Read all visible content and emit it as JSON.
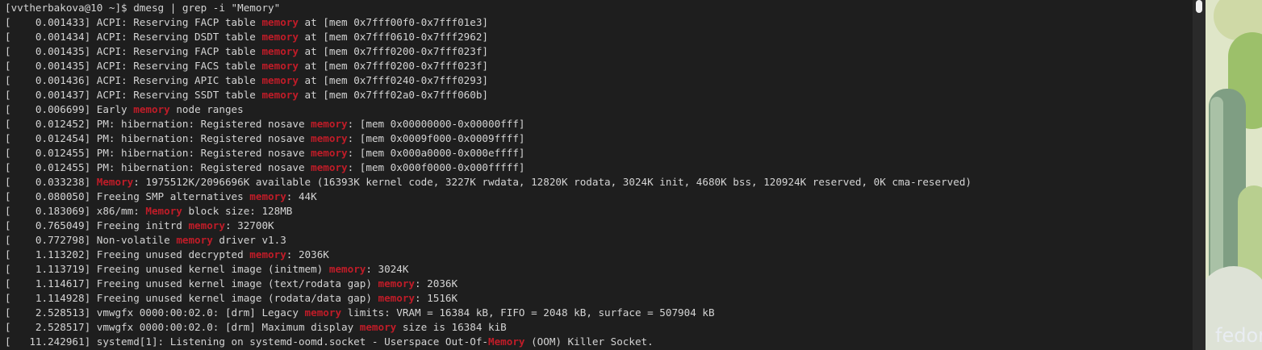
{
  "terminal": {
    "lines": [
      [
        {
          "t": "[vvtherbakova@10 ~]$ dmesg | grep -i \"Memory\""
        }
      ],
      [
        {
          "t": "[    0.001433] ACPI: Reserving FACP table "
        },
        {
          "t": "memory",
          "hl": true
        },
        {
          "t": " at [mem 0x7fff00f0-0x7fff01e3]"
        }
      ],
      [
        {
          "t": "[    0.001434] ACPI: Reserving DSDT table "
        },
        {
          "t": "memory",
          "hl": true
        },
        {
          "t": " at [mem 0x7fff0610-0x7fff2962]"
        }
      ],
      [
        {
          "t": "[    0.001435] ACPI: Reserving FACP table "
        },
        {
          "t": "memory",
          "hl": true
        },
        {
          "t": " at [mem 0x7fff0200-0x7fff023f]"
        }
      ],
      [
        {
          "t": "[    0.001435] ACPI: Reserving FACS table "
        },
        {
          "t": "memory",
          "hl": true
        },
        {
          "t": " at [mem 0x7fff0200-0x7fff023f]"
        }
      ],
      [
        {
          "t": "[    0.001436] ACPI: Reserving APIC table "
        },
        {
          "t": "memory",
          "hl": true
        },
        {
          "t": " at [mem 0x7fff0240-0x7fff0293]"
        }
      ],
      [
        {
          "t": "[    0.001437] ACPI: Reserving SSDT table "
        },
        {
          "t": "memory",
          "hl": true
        },
        {
          "t": " at [mem 0x7fff02a0-0x7fff060b]"
        }
      ],
      [
        {
          "t": "[    0.006699] Early "
        },
        {
          "t": "memory",
          "hl": true
        },
        {
          "t": " node ranges"
        }
      ],
      [
        {
          "t": "[    0.012452] PM: hibernation: Registered nosave "
        },
        {
          "t": "memory",
          "hl": true
        },
        {
          "t": ": [mem 0x00000000-0x00000fff]"
        }
      ],
      [
        {
          "t": "[    0.012454] PM: hibernation: Registered nosave "
        },
        {
          "t": "memory",
          "hl": true
        },
        {
          "t": ": [mem 0x0009f000-0x0009ffff]"
        }
      ],
      [
        {
          "t": "[    0.012455] PM: hibernation: Registered nosave "
        },
        {
          "t": "memory",
          "hl": true
        },
        {
          "t": ": [mem 0x000a0000-0x000effff]"
        }
      ],
      [
        {
          "t": "[    0.012455] PM: hibernation: Registered nosave "
        },
        {
          "t": "memory",
          "hl": true
        },
        {
          "t": ": [mem 0x000f0000-0x000fffff]"
        }
      ],
      [
        {
          "t": "[    0.033238] "
        },
        {
          "t": "Memory",
          "hl": true
        },
        {
          "t": ": 1975512K/2096696K available (16393K kernel code, 3227K rwdata, 12820K rodata, 3024K init, 4680K bss, 120924K reserved, 0K cma-reserved)"
        }
      ],
      [
        {
          "t": "[    0.080050] Freeing SMP alternatives "
        },
        {
          "t": "memory",
          "hl": true
        },
        {
          "t": ": 44K"
        }
      ],
      [
        {
          "t": "[    0.183069] x86/mm: "
        },
        {
          "t": "Memory",
          "hl": true
        },
        {
          "t": " block size: 128MB"
        }
      ],
      [
        {
          "t": "[    0.765049] Freeing initrd "
        },
        {
          "t": "memory",
          "hl": true
        },
        {
          "t": ": 32700K"
        }
      ],
      [
        {
          "t": "[    0.772798] Non-volatile "
        },
        {
          "t": "memory",
          "hl": true
        },
        {
          "t": " driver v1.3"
        }
      ],
      [
        {
          "t": "[    1.113202] Freeing unused decrypted "
        },
        {
          "t": "memory",
          "hl": true
        },
        {
          "t": ": 2036K"
        }
      ],
      [
        {
          "t": "[    1.113719] Freeing unused kernel image (initmem) "
        },
        {
          "t": "memory",
          "hl": true
        },
        {
          "t": ": 3024K"
        }
      ],
      [
        {
          "t": "[    1.114617] Freeing unused kernel image (text/rodata gap) "
        },
        {
          "t": "memory",
          "hl": true
        },
        {
          "t": ": 2036K"
        }
      ],
      [
        {
          "t": "[    1.114928] Freeing unused kernel image (rodata/data gap) "
        },
        {
          "t": "memory",
          "hl": true
        },
        {
          "t": ": 1516K"
        }
      ],
      [
        {
          "t": "[    2.528513] vmwgfx 0000:00:02.0: [drm] Legacy "
        },
        {
          "t": "memory",
          "hl": true
        },
        {
          "t": " limits: VRAM = 16384 kB, FIFO = 2048 kB, surface = 507904 kB"
        }
      ],
      [
        {
          "t": "[    2.528517] vmwgfx 0000:00:02.0: [drm] Maximum display "
        },
        {
          "t": "memory",
          "hl": true
        },
        {
          "t": " size is 16384 kiB"
        }
      ],
      [
        {
          "t": "[   11.242961] systemd[1]: Listening on systemd-oomd.socket - Userspace Out-Of-"
        },
        {
          "t": "Memory",
          "hl": true
        },
        {
          "t": " (OOM) Killer Socket."
        }
      ]
    ],
    "colors": {
      "background": "#1e1e1e",
      "text": "#d4d4d4",
      "match_highlight": "#c01c28"
    }
  },
  "desktop": {
    "brand_text": "fedora"
  }
}
